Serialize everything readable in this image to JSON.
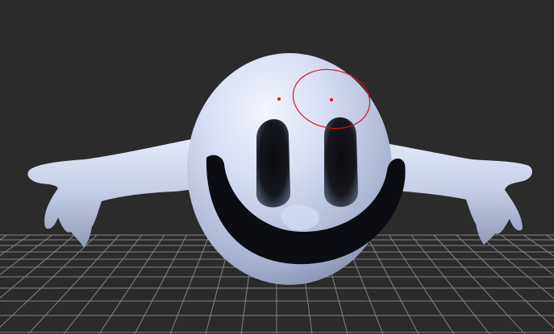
{
  "viewport": {
    "background": "#2b2b2b",
    "grid_color": "#8d8d8d",
    "model_color": "#c9d2ea",
    "marker_color": "#e0101c",
    "grid": true
  }
}
